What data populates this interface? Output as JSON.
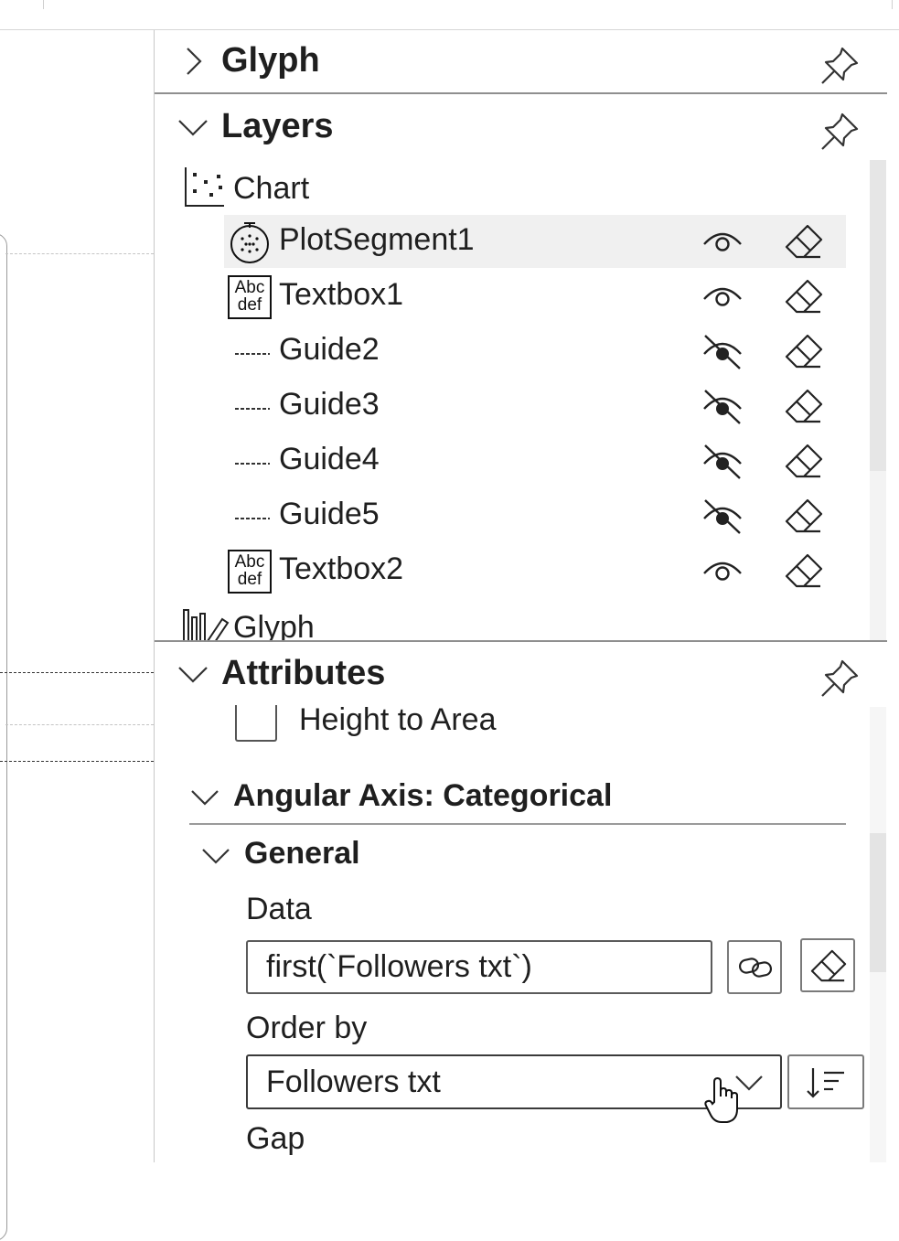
{
  "panels": {
    "glyph": {
      "title": "Glyph",
      "expanded": false
    },
    "layers": {
      "title": "Layers",
      "expanded": true,
      "root": {
        "label": "Chart",
        "icon": "scatter-chart-icon"
      },
      "items": [
        {
          "label": "PlotSegment1",
          "icon": "polar-plot-icon",
          "visible": true,
          "selected": true
        },
        {
          "label": "Textbox1",
          "icon": "textbox-icon",
          "icon_text": [
            "Abc",
            "def"
          ],
          "visible": true
        },
        {
          "label": "Guide2",
          "icon": "guide-icon",
          "visible": false
        },
        {
          "label": "Guide3",
          "icon": "guide-icon",
          "visible": false
        },
        {
          "label": "Guide4",
          "icon": "guide-icon",
          "visible": false
        },
        {
          "label": "Guide5",
          "icon": "guide-icon",
          "visible": false
        },
        {
          "label": "Textbox2",
          "icon": "textbox-icon",
          "icon_text": [
            "Abc",
            "def"
          ],
          "visible": true
        }
      ],
      "next_group": {
        "label": "Glyph",
        "icon": "glyph-icon"
      }
    },
    "attributes": {
      "title": "Attributes",
      "expanded": true,
      "height_to_area": {
        "label": "Height to Area",
        "checked": false
      },
      "angular_axis": {
        "title": "Angular Axis: Categorical",
        "general": {
          "title": "General",
          "data_label": "Data",
          "data_value": "first(`Followers txt`)",
          "order_by_label": "Order by",
          "order_by_value": "Followers txt",
          "gap_label": "Gap"
        }
      }
    }
  },
  "colors": {
    "selected_row": "#f0f0f0",
    "divider": "#8f8f8f",
    "text": "#1f1f1f"
  }
}
